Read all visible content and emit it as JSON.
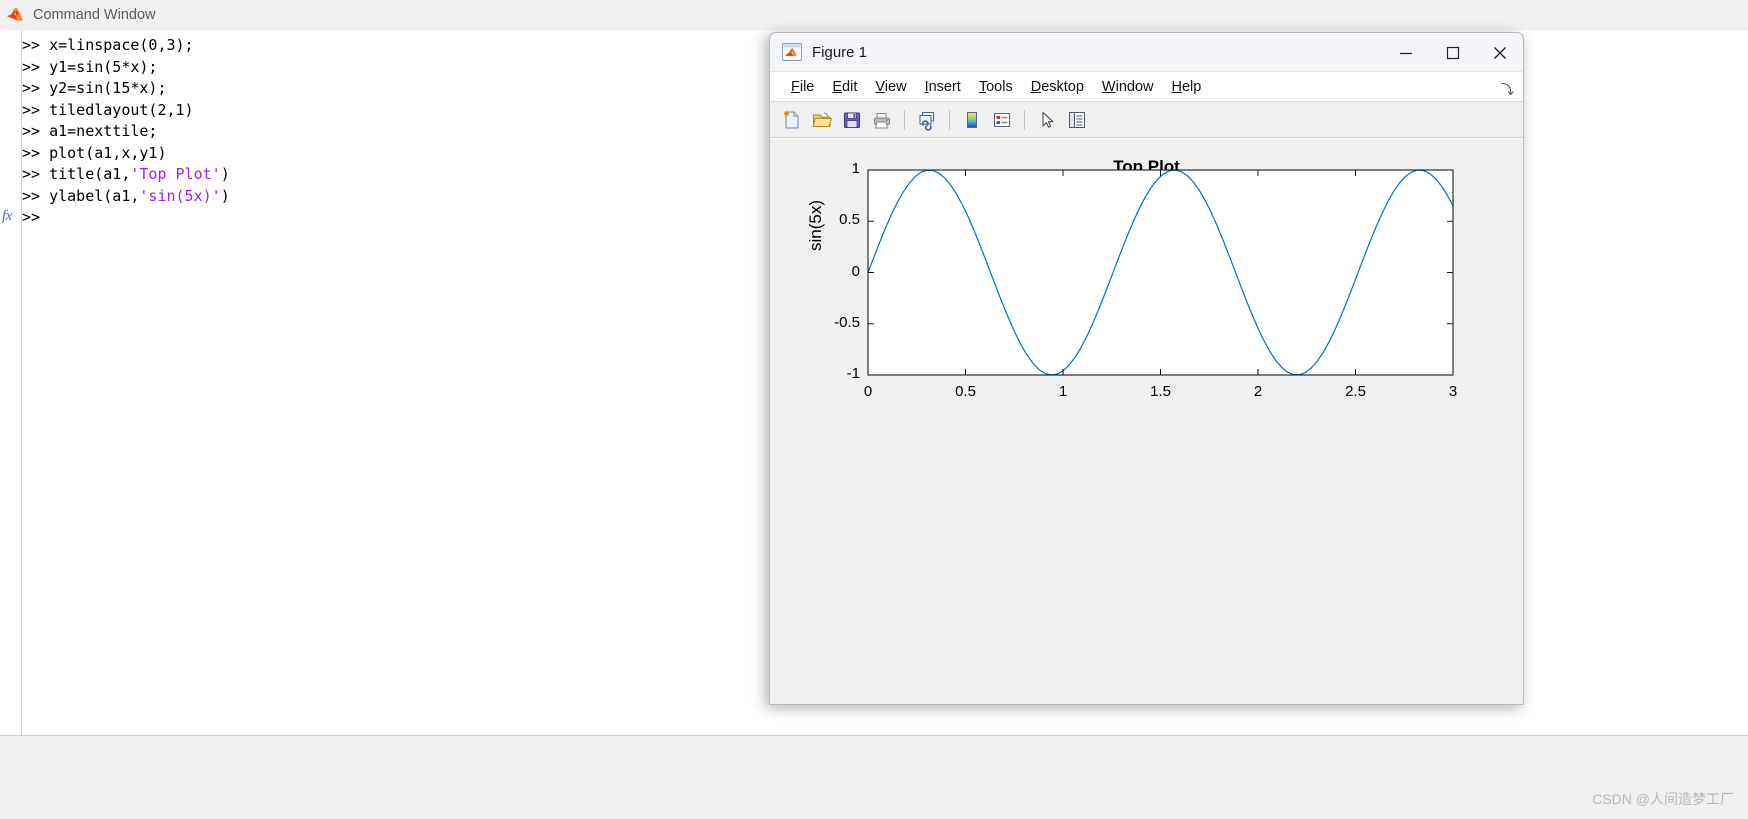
{
  "command_window": {
    "title": "Command Window",
    "app_icon": "matlab-logo-icon",
    "prompt": ">>",
    "fx_marker": "fx",
    "lines": [
      {
        "prompt": ">> ",
        "code": "x=linspace(0,3);",
        "string": ""
      },
      {
        "prompt": ">> ",
        "code": "y1=sin(5*x);",
        "string": ""
      },
      {
        "prompt": ">> ",
        "code": "y2=sin(15*x);",
        "string": ""
      },
      {
        "prompt": ">> ",
        "code": "tiledlayout(2,1)",
        "string": ""
      },
      {
        "prompt": ">> ",
        "code": "a1=nexttile;",
        "string": ""
      },
      {
        "prompt": ">> ",
        "code": "plot(a1,x,y1)",
        "string": ""
      },
      {
        "prompt": ">> ",
        "code": "title(a1,",
        "string": "'Top Plot'",
        "code_after": ")"
      },
      {
        "prompt": ">> ",
        "code": "ylabel(a1,",
        "string": "'sin(5x)'",
        "code_after": ")"
      }
    ],
    "current_prompt": ">>",
    "watermark": "CSDN @人间造梦工厂"
  },
  "figure_window": {
    "title": "Figure 1",
    "icon": "matlab-figure-icon",
    "window_controls": {
      "minimize": "minimize-icon",
      "maximize": "maximize-icon",
      "close": "close-icon"
    },
    "menu": [
      {
        "label": "File",
        "mnemonic": "F"
      },
      {
        "label": "Edit",
        "mnemonic": "E"
      },
      {
        "label": "View",
        "mnemonic": "V"
      },
      {
        "label": "Insert",
        "mnemonic": "I"
      },
      {
        "label": "Tools",
        "mnemonic": "T"
      },
      {
        "label": "Desktop",
        "mnemonic": "D"
      },
      {
        "label": "Window",
        "mnemonic": "W"
      },
      {
        "label": "Help",
        "mnemonic": "H"
      }
    ],
    "menubar_expander": "⤵",
    "toolbar": [
      {
        "name": "new-figure-icon",
        "tooltip": "New Figure"
      },
      {
        "name": "open-file-icon",
        "tooltip": "Open File"
      },
      {
        "name": "save-figure-icon",
        "tooltip": "Save Figure"
      },
      {
        "name": "print-figure-icon",
        "tooltip": "Print Figure"
      },
      {
        "separator": true
      },
      {
        "name": "link-plot-icon",
        "tooltip": "Link Plot"
      },
      {
        "separator": true
      },
      {
        "name": "insert-colorbar-icon",
        "tooltip": "Insert Colorbar"
      },
      {
        "name": "insert-legend-icon",
        "tooltip": "Insert Legend"
      },
      {
        "separator": true
      },
      {
        "name": "edit-plot-arrow-icon",
        "tooltip": "Edit Plot"
      },
      {
        "name": "show-plot-tools-icon",
        "tooltip": "Show Plot Tools and Dock Figure"
      }
    ]
  },
  "chart_data": {
    "type": "line",
    "title": "Top Plot",
    "xlabel": "",
    "ylabel": "sin(5x)",
    "xlim": [
      0,
      3
    ],
    "ylim": [
      -1,
      1
    ],
    "xticks": [
      0,
      0.5,
      1,
      1.5,
      2,
      2.5,
      3
    ],
    "xticklabels": [
      "0",
      "0.5",
      "1",
      "1.5",
      "2",
      "2.5",
      "3"
    ],
    "yticks": [
      1,
      0.5,
      0,
      -0.5,
      -1
    ],
    "yticklabels": [
      "1",
      "0.5",
      "0",
      "-0.5",
      "-1"
    ],
    "grid": false,
    "legend": null,
    "series": [
      {
        "name": "sin(5x)",
        "color": "#0072BD",
        "linewidth": 1.2,
        "expression": "sin(5*x)",
        "x_start": 0,
        "x_end": 3,
        "n_points": 100
      }
    ],
    "axes_box": true,
    "background": "#ffffff",
    "figure_background": "#f0f0f0"
  },
  "colors": {
    "line": "#0072BD",
    "figure_bg": "#f0f0f0",
    "axes_bg": "#ffffff",
    "axes_border": "#1a1a1a",
    "string_literal": "#a020f0",
    "titlebar": "#f3f5f9",
    "watermark": "#b9b9b9"
  }
}
